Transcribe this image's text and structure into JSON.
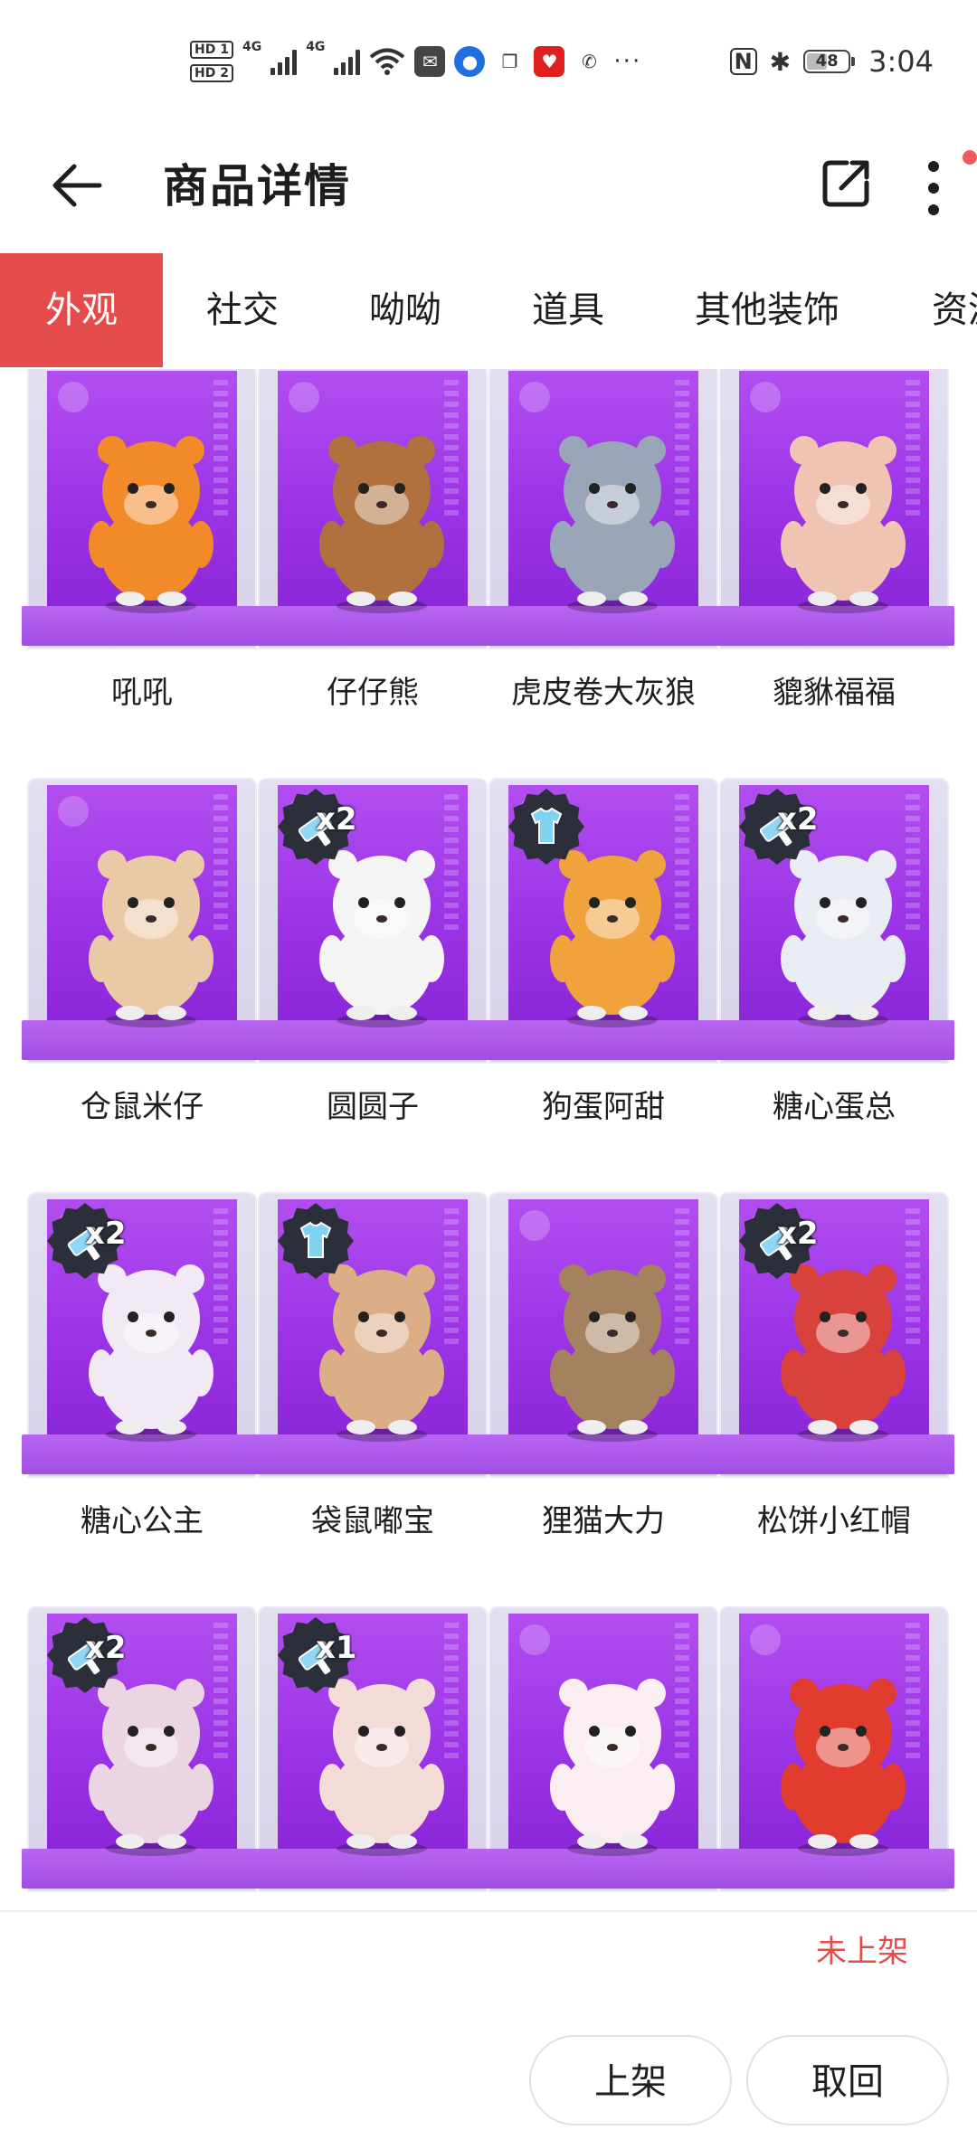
{
  "status_bar": {
    "hd1": "HD 1",
    "hd2": "HD 2",
    "net1": "4G",
    "net2": "4G",
    "battery": "48",
    "time": "3:04",
    "icons": [
      "signal-icon",
      "wifi-icon",
      "mail-icon",
      "bulb-icon",
      "copy-icon",
      "heart-app-icon",
      "wechat-icon",
      "more-dots-icon",
      "nfc-icon",
      "bluetooth-icon",
      "battery-icon"
    ]
  },
  "header": {
    "title": "商品详情",
    "icons": [
      "back-arrow-icon",
      "share-icon",
      "more-vertical-icon"
    ]
  },
  "tabs": [
    "外观",
    "社交",
    "呦呦",
    "道具",
    "其他装饰",
    "资源"
  ],
  "active_tab": "外观",
  "items": [
    {
      "name": "吼吼",
      "badge": "",
      "badge_type": "",
      "color": "#f28a2a"
    },
    {
      "name": "仔仔熊",
      "badge": "",
      "badge_type": "",
      "color": "#b0713f"
    },
    {
      "name": "虎皮卷大灰狼",
      "badge": "",
      "badge_type": "",
      "color": "#9aa5b8"
    },
    {
      "name": "貔貅福福",
      "badge": "",
      "badge_type": "",
      "color": "#efc4b2"
    },
    {
      "name": "仓鼠米仔",
      "badge": "",
      "badge_type": "",
      "color": "#e9c9a6"
    },
    {
      "name": "圆圆子",
      "badge": "x2",
      "badge_type": "paint",
      "color": "#f4f4f4"
    },
    {
      "name": "狗蛋阿甜",
      "badge": "",
      "badge_type": "shirt",
      "color": "#f0a23c"
    },
    {
      "name": "糖心蛋总",
      "badge": "x2",
      "badge_type": "paint",
      "color": "#e9ecf3"
    },
    {
      "name": "糖心公主",
      "badge": "x2",
      "badge_type": "paint",
      "color": "#f1eaf4"
    },
    {
      "name": "袋鼠嘟宝",
      "badge": "",
      "badge_type": "shirt",
      "color": "#dcae88"
    },
    {
      "name": "狸猫大力",
      "badge": "",
      "badge_type": "",
      "color": "#a4825f"
    },
    {
      "name": "松饼小红帽",
      "badge": "x2",
      "badge_type": "paint",
      "color": "#d8413c"
    },
    {
      "name": "",
      "badge": "x2",
      "badge_type": "paint",
      "color": "#ecd5e3"
    },
    {
      "name": "",
      "badge": "x1",
      "badge_type": "paint",
      "color": "#f3dbd8"
    },
    {
      "name": "",
      "badge": "",
      "badge_type": "",
      "color": "#fbeef0"
    },
    {
      "name": "",
      "badge": "",
      "badge_type": "",
      "color": "#e23c2e"
    }
  ],
  "footer": {
    "status": "未上架",
    "list_button": "上架",
    "withdraw_button": "取回"
  },
  "colors": {
    "accent": "#e44b4b",
    "card_purple": "#9b33e6"
  }
}
